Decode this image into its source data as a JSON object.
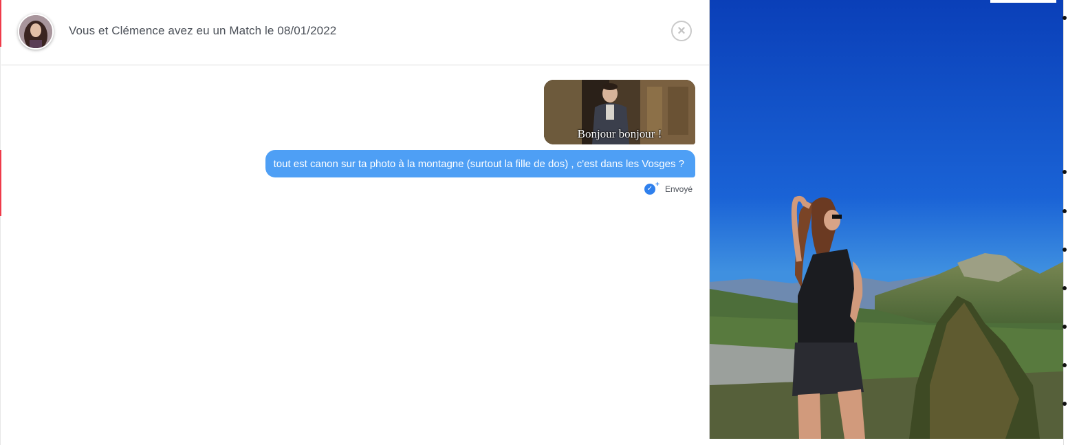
{
  "header": {
    "match_text": "Vous et Clémence avez eu un Match le 08/01/2022",
    "close_icon": "close-circle-icon",
    "avatar_icon": "profile-avatar"
  },
  "messages": [
    {
      "type": "gif",
      "caption": "Bonjour bonjour !"
    },
    {
      "type": "text",
      "text": "tout est canon sur ta photo à la montagne (surtout la fille de dos) , c'est dans les Vosges ?"
    }
  ],
  "status": {
    "label": "Envoyé",
    "icon": "double-check-icon"
  },
  "photo": {
    "description_icon": "profile-photo-mountain"
  },
  "colors": {
    "accent": "#ef3b4a",
    "bubble": "#4e9ff5",
    "sent_icon": "#2f80ed",
    "sky": "#1a63d6"
  }
}
